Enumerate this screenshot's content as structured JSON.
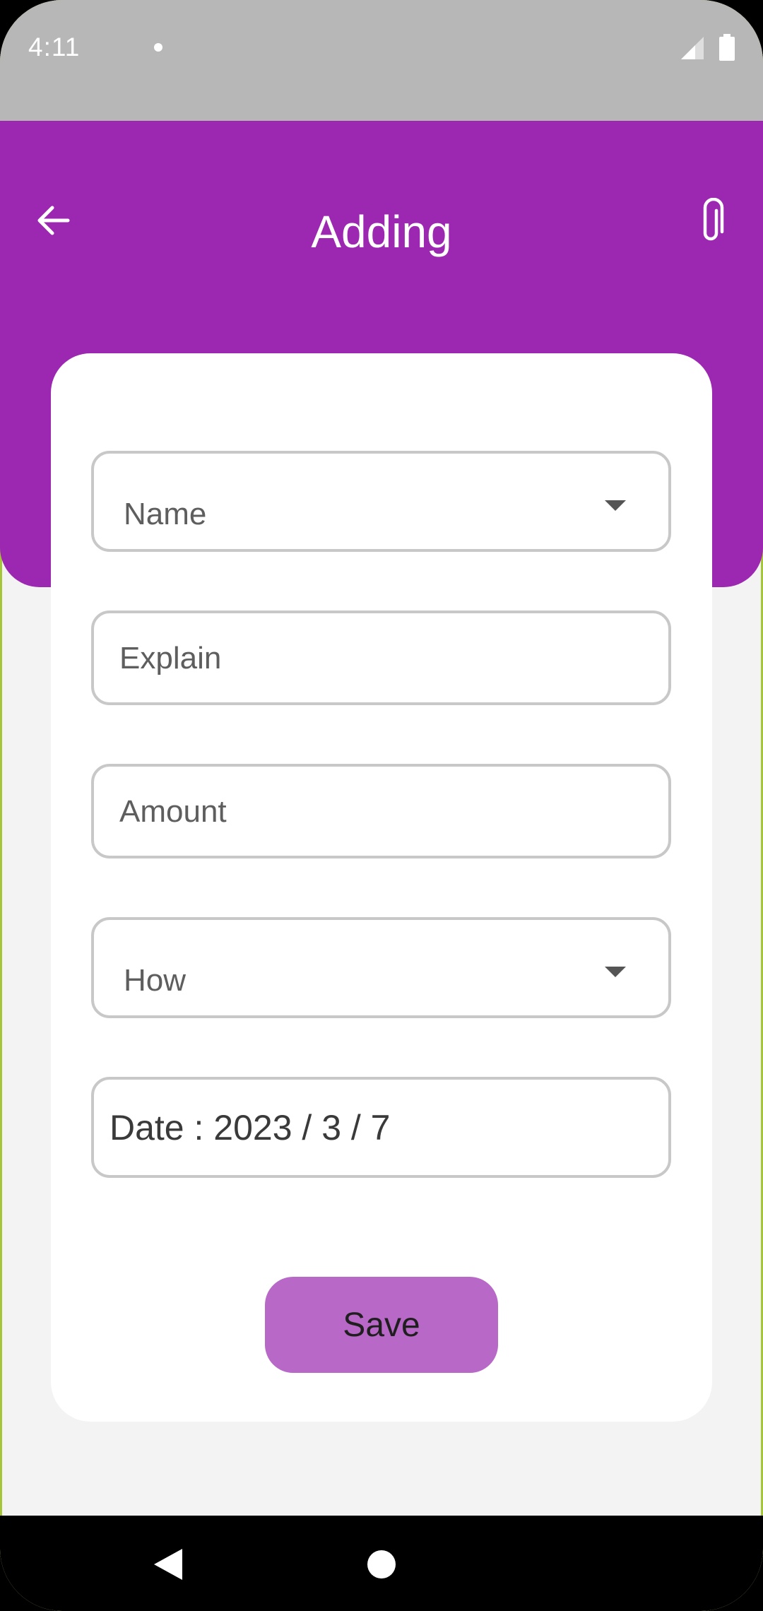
{
  "status_bar": {
    "time": "4:11"
  },
  "header": {
    "title": "Adding"
  },
  "form": {
    "name_label": "Name",
    "explain_placeholder": "Explain",
    "amount_placeholder": "Amount",
    "how_label": "How",
    "date_text": "Date : 2023 / 3 / 7"
  },
  "actions": {
    "save_label": "Save"
  },
  "colors": {
    "header_bg": "#9c27b0",
    "save_button_bg": "#b868c6",
    "status_bar_bg": "#b7b7b7",
    "page_bg": "#f3f3f3"
  },
  "icons": {
    "back": "arrow-left",
    "attach": "paperclip",
    "signal": "cell-signal",
    "battery": "battery-full",
    "dropdown": "caret-down",
    "nav_back": "triangle-back",
    "nav_home": "circle-home"
  }
}
